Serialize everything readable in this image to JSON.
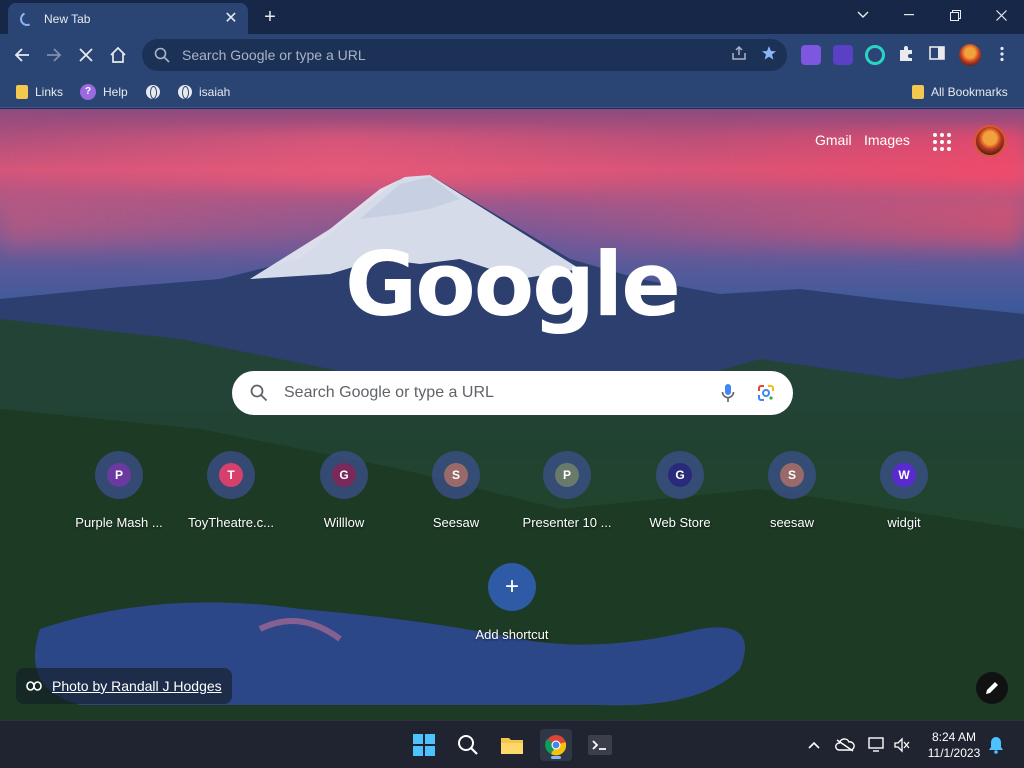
{
  "browser": {
    "tab_title": "New Tab",
    "tab_close": "✕",
    "new_tab": "+",
    "omnibox_placeholder": "Search Google or type a URL"
  },
  "bookmarks": [
    {
      "label": "Links",
      "icon": "folder-icon"
    },
    {
      "label": "Help",
      "icon": "help-icon"
    },
    {
      "label": "",
      "icon": "globe-icon"
    },
    {
      "label": "isaiah",
      "icon": "globe-icon"
    }
  ],
  "all_bookmarks": "All Bookmarks",
  "ntp": {
    "gmail": "Gmail",
    "images": "Images",
    "logo": "Google",
    "search_placeholder": "Search Google or type a URL",
    "add_shortcut": "Add shortcut",
    "photo_credit": "Photo by Randall J Hodges"
  },
  "shortcuts": [
    {
      "letter": "P",
      "label": "Purple Mash ...",
      "color": "#6a3aa0"
    },
    {
      "letter": "T",
      "label": "ToyTheatre.c...",
      "color": "#d6406c"
    },
    {
      "letter": "G",
      "label": "Willlow",
      "color": "#7a2a5a"
    },
    {
      "letter": "S",
      "label": "Seesaw",
      "color": "#9a6a6a"
    },
    {
      "letter": "P",
      "label": "Presenter 10 ...",
      "color": "#6a7a6a"
    },
    {
      "letter": "G",
      "label": "Web Store",
      "color": "#2a2a7a"
    },
    {
      "letter": "S",
      "label": "seesaw",
      "color": "#9a6a6a"
    },
    {
      "letter": "W",
      "label": "widgit",
      "color": "#5a2ad0"
    }
  ],
  "taskbar": {
    "time": "8:24 AM",
    "date": "11/1/2023"
  },
  "colors": {
    "tabstrip": "#162747",
    "toolbar": "#2a4574",
    "accent": "#8ab4f8"
  }
}
